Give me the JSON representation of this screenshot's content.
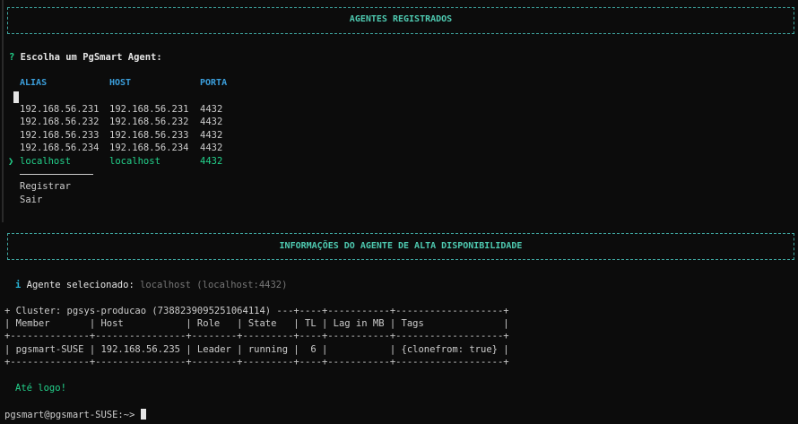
{
  "box1": {
    "title": "AGENTES REGISTRADOS"
  },
  "prompt": {
    "mark": "?",
    "text": "Escolha um PgSmart Agent:"
  },
  "table": {
    "headers": {
      "alias": "ALIAS",
      "host": "HOST",
      "porta": "PORTA"
    },
    "rows": [
      {
        "alias": "192.168.56.231",
        "host": "192.168.56.231",
        "porta": "4432"
      },
      {
        "alias": "192.168.56.232",
        "host": "192.168.56.232",
        "porta": "4432"
      },
      {
        "alias": "192.168.56.233",
        "host": "192.168.56.233",
        "porta": "4432"
      },
      {
        "alias": "192.168.56.234",
        "host": "192.168.56.234",
        "porta": "4432"
      }
    ],
    "selected": {
      "pointer": "❯",
      "alias": "localhost",
      "host": "localhost",
      "porta": "4432"
    }
  },
  "menu": {
    "register": "Registrar",
    "exit": "Sair"
  },
  "box2": {
    "title": "INFORMAÇÕES DO AGENTE DE ALTA DISPONIBILIDADE"
  },
  "info": {
    "mark": "i",
    "label": "Agente selecionado:",
    "value": "localhost (localhost:4432)"
  },
  "cluster": {
    "lines": [
      "+ Cluster: pgsys-producao (7388239095251064114) ---+----+-----------+-------------------+",
      "| Member       | Host           | Role   | State   | TL | Lag in MB | Tags              |",
      "+--------------+----------------+--------+---------+----+-----------+-------------------+",
      "| pgsmart-SUSE | 192.168.56.235 | Leader | running |  6 |           | {clonefrom: true} |",
      "+--------------+----------------+--------+---------+----+-----------+-------------------+"
    ]
  },
  "farewell": "Até logo!",
  "shell_prompt": "pgsmart@pgsmart-SUSE:~>",
  "colors": {
    "background": "#0c0c0c",
    "foreground": "#cccccc",
    "box_border": "#3fa7a1",
    "header_blue": "#3b9edb",
    "green": "#23d18b",
    "cyan": "#29b8db",
    "dim": "#767676"
  }
}
